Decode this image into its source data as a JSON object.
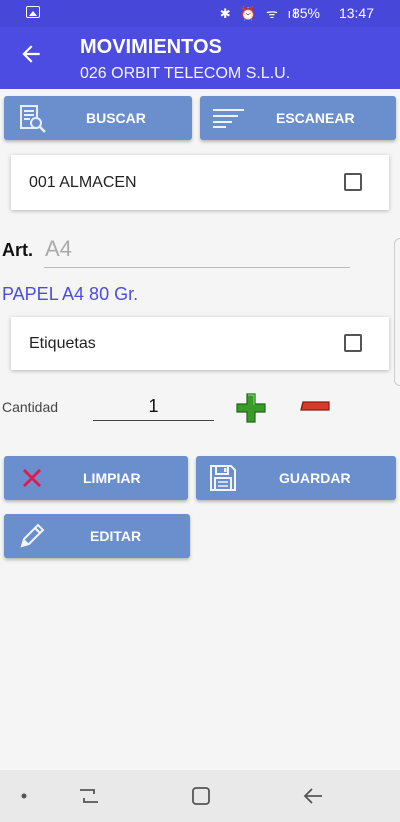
{
  "status_bar": {
    "icons": "✱ ⏰ ᯤ ıl",
    "battery": "85%",
    "time": "13:47"
  },
  "header": {
    "title": "MOVIMIENTOS",
    "subtitle": "026 ORBIT TELECOM S.L.U."
  },
  "toolbar": {
    "search_label": "BUSCAR",
    "scan_label": "ESCANEAR"
  },
  "warehouse": {
    "label": "001 ALMACEN",
    "checked": false
  },
  "article": {
    "label": "Art.",
    "code": "A4",
    "name": "PAPEL A4 80 Gr."
  },
  "labels_option": {
    "label": "Etiquetas",
    "checked": false
  },
  "quantity": {
    "label": "Cantidad",
    "value": "1"
  },
  "actions": {
    "clear_label": "LIMPIAR",
    "save_label": "GUARDAR",
    "edit_label": "EDITAR"
  },
  "colors": {
    "primary": "#4c4ce3",
    "status_bar": "#4747d9",
    "button": "#6b8ecd",
    "plus": "#3a9a2a",
    "minus": "#d83a2a",
    "clear_x": "#e0194e"
  }
}
